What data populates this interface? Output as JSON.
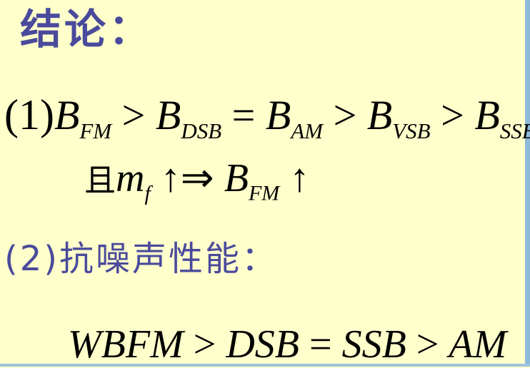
{
  "title": "结论：",
  "line1": {
    "label": "(1)",
    "B": "B",
    "sub_fm": "FM",
    "sub_dsb": "DSB",
    "sub_am": "AM",
    "sub_vsb": "VSB",
    "sub_ssb": "SSB",
    "gt": ">",
    "eq": "="
  },
  "line2": {
    "cjk": "且",
    "m": "m",
    "sub_f": "f",
    "arrow_up": "↑",
    "implies": "⇒",
    "B": "B",
    "sub_fm": "FM"
  },
  "line3": {
    "text": "(2)抗噪声性能："
  },
  "line4": {
    "wbfm": "WBFM",
    "dsb": "DSB",
    "ssb": "SSB",
    "am": "AM",
    "gt": ">",
    "eq": "="
  },
  "colors": {
    "background": "#ffffcc",
    "heading": "#4a4a9c",
    "stripe": "#8eb9d9"
  }
}
